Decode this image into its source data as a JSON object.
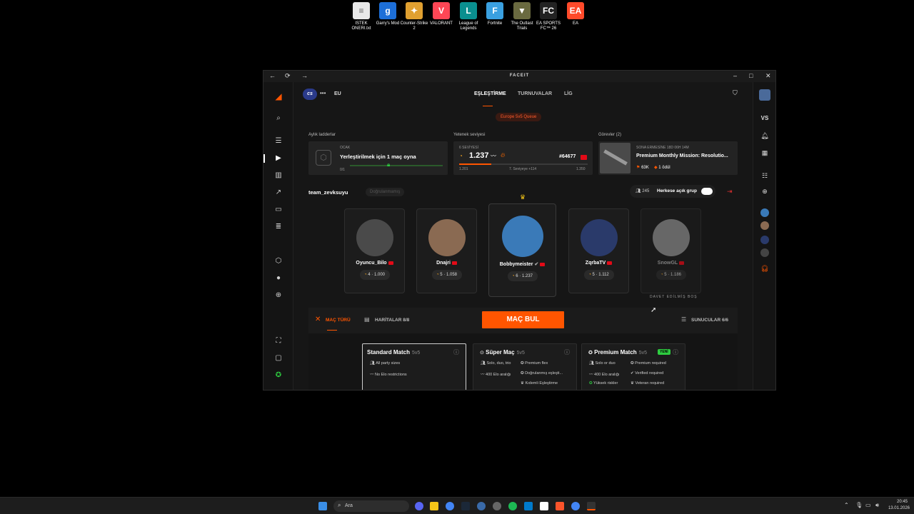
{
  "desktop": {
    "icons": [
      {
        "label": "ISTEK ONERI.txt",
        "color": "#e8e8e8",
        "glyph": "≡"
      },
      {
        "label": "Garry's Mod",
        "color": "#1d6fd8",
        "glyph": "g"
      },
      {
        "label": "Counter-Strike 2",
        "color": "#e0a030",
        "glyph": "✦"
      },
      {
        "label": "VALORANT",
        "color": "#ff4655",
        "glyph": "V"
      },
      {
        "label": "League of Legends",
        "color": "#0a8f8f",
        "glyph": "L"
      },
      {
        "label": "Fortnite",
        "color": "#3aa0e0",
        "glyph": "F"
      },
      {
        "label": "The Outlast Trials",
        "color": "#6a6a40",
        "glyph": "▼"
      },
      {
        "label": "EA SPORTS FC™ 26",
        "color": "#222222",
        "glyph": "FC"
      },
      {
        "label": "EA",
        "color": "#ff4a2a",
        "glyph": "EA"
      }
    ]
  },
  "window": {
    "title": "FACEIT",
    "back": "←",
    "refresh": "⟳",
    "forward": "→",
    "minimize": "–",
    "maximize": "□",
    "close": "✕"
  },
  "header": {
    "game": "cs",
    "menu": "•••",
    "region": "EU",
    "tabs": [
      "EŞLEŞTİRME",
      "TURNUVALAR",
      "LİG"
    ],
    "queue_badge": "Europe 5v5 Queue"
  },
  "ladders": {
    "label": "Aylık ladderlar",
    "month": "OCAK",
    "text": "Yerleştirilmek için 1 maç oyna",
    "progress": "0/1",
    "progress_fraction": 0
  },
  "skill": {
    "label": "Yetenek seviyesi",
    "level_label": "6 SEVİYESİ",
    "elo": "1.237",
    "rank": "#64677",
    "min": "1.201",
    "next": "7. Seviyeye +114",
    "max": "1.350",
    "progress_fraction": 0.25
  },
  "missions": {
    "label": "Görevler (2)",
    "timer": "SONA ERMESİNE 18D 06H 14M",
    "title": "Premium Monthly Mission: Resolutio...",
    "reward1": "63K",
    "reward2": "1 ödül"
  },
  "team": {
    "name": "team_zevksuyu",
    "status": "Doğrulanmamış",
    "count": "245",
    "group_label": "Herkese açık grup"
  },
  "players": [
    {
      "name": "Oyuncu_Bilo",
      "level": "4",
      "elo": "1.000",
      "avatar": "#4a4a4a"
    },
    {
      "name": "Dnajri",
      "level": "5",
      "elo": "1.058",
      "avatar": "#8a6a52"
    },
    {
      "name": "Bobbymeister",
      "level": "6",
      "elo": "1.237",
      "avatar": "#3a7ab8"
    },
    {
      "name": "ZqrbaTV",
      "level": "5",
      "elo": "1.112",
      "avatar": "#2a3a6a"
    },
    {
      "name": "SnowGL",
      "level": "5",
      "elo": "1.186",
      "avatar": "#8a8a8a"
    }
  ],
  "invite_status": "DAVET EDİLMİŞ BOŞ",
  "match_bar": {
    "match_type": "MAÇ TÜRÜ",
    "maps": "HARİTALAR 8/8",
    "find": "MAÇ BUL",
    "servers": "SUNUCULAR 6/6"
  },
  "modes": [
    {
      "title": "Standard Match",
      "size": "5v5",
      "badge": "",
      "features": [
        "All party sizes",
        "No Elo restrictions",
        "",
        "",
        "",
        ""
      ]
    },
    {
      "title": "Süper Maç",
      "size": "5v5",
      "badge": "",
      "features": [
        "Solo, duo, trio",
        "400 Elo aralığı",
        "Premium flex",
        "Doğrulanmış eşleşti...",
        "",
        "Kıdemli Eşleştirme"
      ]
    },
    {
      "title": "Premium Match",
      "size": "5v5",
      "badge": "YENİ",
      "features": [
        "Solo or duo",
        "400 Elo aralığı",
        "Yüksek riskler",
        "Premium required",
        "Verified required",
        "Veteran required"
      ]
    }
  ],
  "right_nav": {
    "vs": "VS"
  },
  "taskbar": {
    "search": "Ara",
    "time": "20:45",
    "date": "13.01.2026"
  },
  "colors": {
    "accent": "#ff5500",
    "card": "#232323",
    "bg": "#161616"
  }
}
